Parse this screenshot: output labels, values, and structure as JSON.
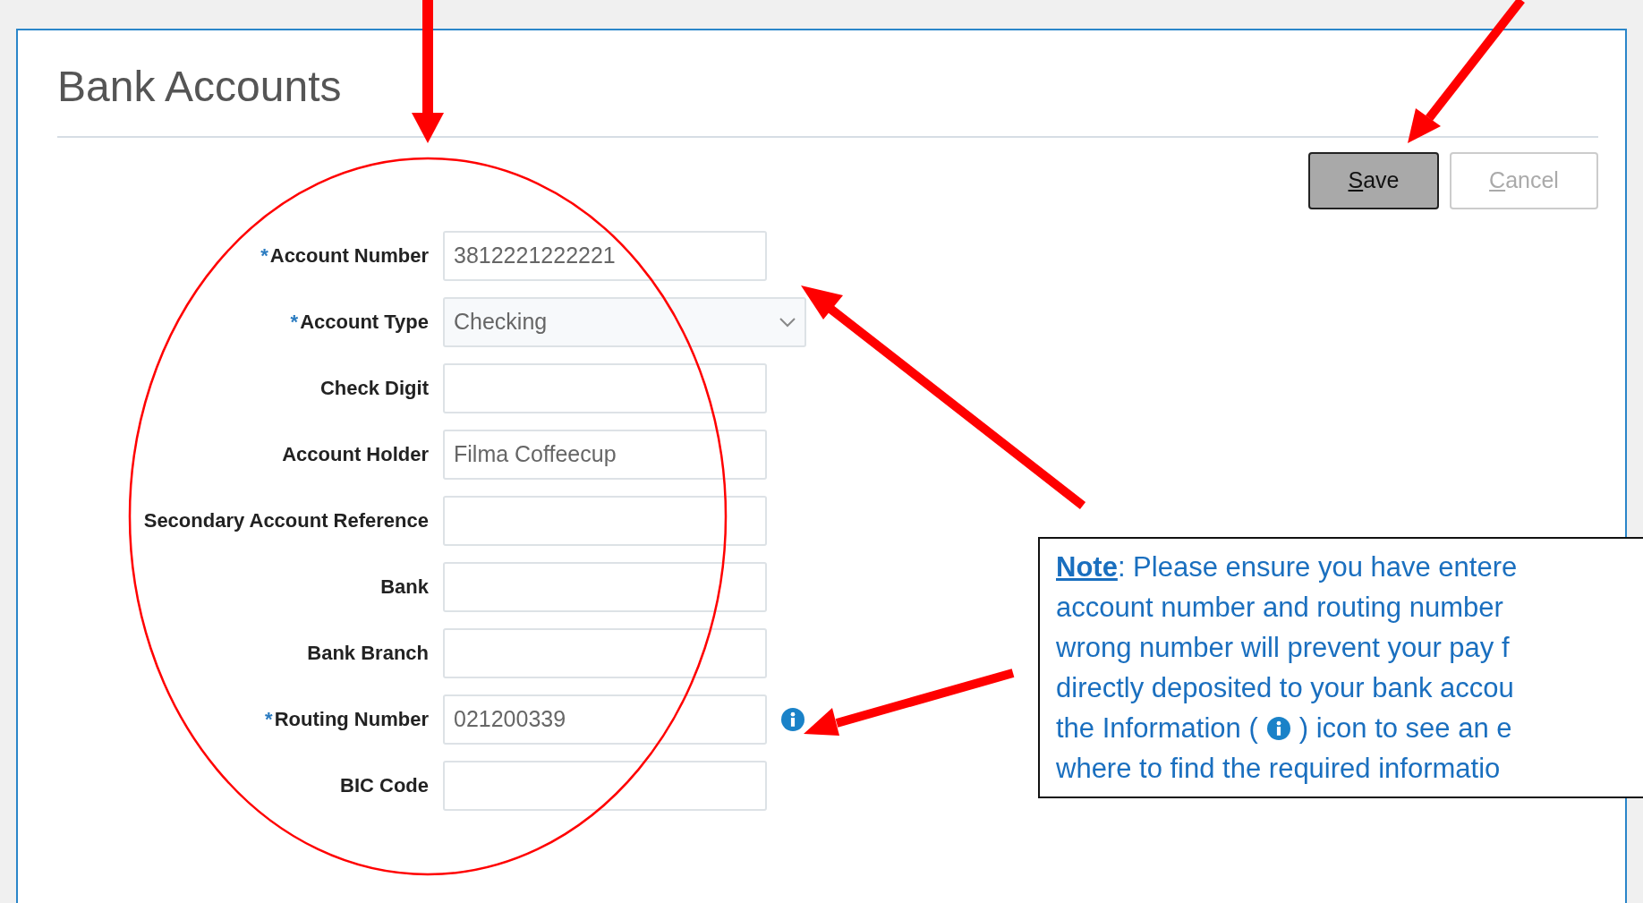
{
  "page": {
    "title": "Bank Accounts"
  },
  "buttons": [
    {
      "label": "Save",
      "kind": "primary"
    },
    {
      "label": "Cancel",
      "kind": "secondary"
    }
  ],
  "fields": [
    {
      "marker": "*",
      "label": "Account Number",
      "kind": "text",
      "value": "3812221222221"
    },
    {
      "marker": "*",
      "label": "Account Type",
      "kind": "select",
      "value": "Checking"
    },
    {
      "label": "Check Digit",
      "kind": "text"
    },
    {
      "label": "Account Holder",
      "kind": "text",
      "value": "Filma Coffeecup"
    },
    {
      "label": "Secondary Account Reference",
      "kind": "text"
    },
    {
      "label": "Bank",
      "kind": "text"
    },
    {
      "label": "Bank Branch",
      "kind": "text"
    },
    {
      "marker": "*",
      "label": "Routing Number",
      "kind": "text",
      "value": "021200339",
      "info": true
    },
    {
      "label": "BIC Code",
      "kind": "text"
    }
  ],
  "note": {
    "lines": [
      {
        "kind": "text",
        "text": "**Note**:  Please ensure you have entere"
      },
      {
        "kind": "text",
        "text": "account number and routing number"
      },
      {
        "kind": "text",
        "text": "wrong number will prevent your pay f"
      },
      {
        "kind": "text",
        "text": "directly deposited to your bank accou"
      },
      {
        "kind": "icon",
        "before": "the Information (",
        "after": ") icon to see an e"
      },
      {
        "kind": "text",
        "text": "where to find the required informatio"
      }
    ]
  }
}
